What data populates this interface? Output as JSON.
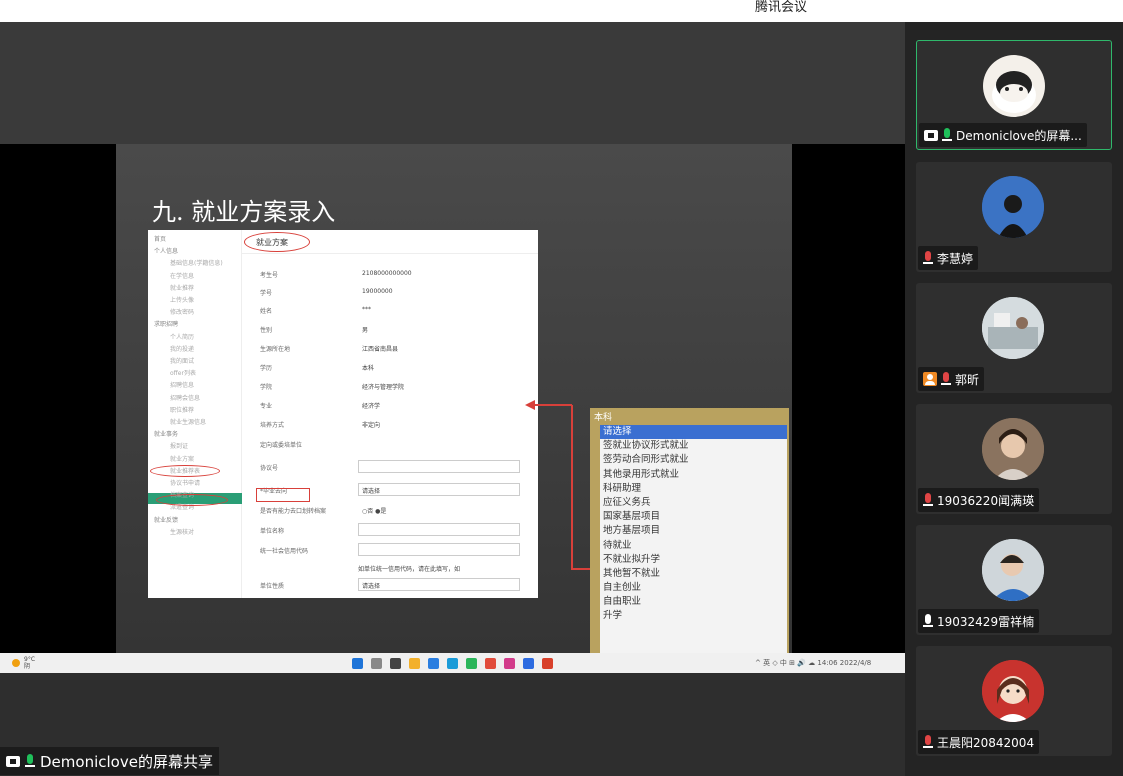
{
  "window": {
    "title": "腾讯会议"
  },
  "slide": {
    "title": "九. 就业方案录入",
    "screenshot": {
      "header_tab": "就业方案",
      "sidebar": [
        {
          "label": "首页",
          "sub": false
        },
        {
          "label": "个人信息",
          "sub": false
        },
        {
          "label": "基础信息(学籍信息)",
          "sub": true
        },
        {
          "label": "在学信息",
          "sub": true
        },
        {
          "label": "就业推荐",
          "sub": true
        },
        {
          "label": "上传头像",
          "sub": true
        },
        {
          "label": "修改密码",
          "sub": true
        },
        {
          "label": "求职招聘",
          "sub": false
        },
        {
          "label": "个人简历",
          "sub": true
        },
        {
          "label": "我的投递",
          "sub": true
        },
        {
          "label": "我的面试",
          "sub": true
        },
        {
          "label": "offer列表",
          "sub": true
        },
        {
          "label": "招聘信息",
          "sub": true
        },
        {
          "label": "招聘会信息",
          "sub": true
        },
        {
          "label": "职位推荐",
          "sub": true
        },
        {
          "label": "就业生源信息",
          "sub": true
        },
        {
          "label": "就业事务",
          "sub": false
        },
        {
          "label": "报到证",
          "sub": true
        },
        {
          "label": "就业方案",
          "sub": true
        },
        {
          "label": "就业推荐表",
          "sub": true
        },
        {
          "label": "协议书申请",
          "sub": true
        },
        {
          "label": "档案查询",
          "sub": true
        },
        {
          "label": "派遣查询",
          "sub": true
        },
        {
          "label": "就业反馈",
          "sub": false
        },
        {
          "label": "生源核对",
          "sub": true
        }
      ],
      "fields": [
        {
          "label": "考生号",
          "value": "2108000000000"
        },
        {
          "label": "学号",
          "value": "19000000"
        },
        {
          "label": "姓名",
          "value": "***"
        },
        {
          "label": "性别",
          "value": "男"
        },
        {
          "label": "生源所在地",
          "value": "江西省南昌县"
        },
        {
          "label": "学历",
          "value": "本科"
        },
        {
          "label": "学院",
          "value": "经济与管理学院"
        },
        {
          "label": "专业",
          "value": "经济学"
        },
        {
          "label": "培养方式",
          "value": "非定向"
        },
        {
          "label": "定向或委培单位",
          "value": ""
        },
        {
          "label": "协议号",
          "value": ""
        },
        {
          "label": "*毕业去向",
          "value": "请选择"
        },
        {
          "label": "是否有能力去口划转档案",
          "value": "○否 ●是"
        },
        {
          "label": "单位名称",
          "value": ""
        },
        {
          "label": "统一社会信用代码",
          "value": ""
        },
        {
          "label": "",
          "value": "如单位统一信用代码，请在此填写，如"
        },
        {
          "label": "单位性质",
          "value": "请选择"
        }
      ]
    },
    "dropdown": {
      "header": "本科",
      "options": [
        "请选择",
        "签就业协议形式就业",
        "签劳动合同形式就业",
        "其他录用形式就业",
        "科研助理",
        "应征义务兵",
        "国家基层项目",
        "地方基层项目",
        "待就业",
        "不就业拟升学",
        "其他暂不就业",
        "自主创业",
        "自由职业",
        "升学"
      ],
      "selected": "请选择"
    }
  },
  "taskbar": {
    "weather_temp": "9°C",
    "weather_text": "阴",
    "tray_text": "^ 英 ◇ 中 ⊞ 🔊 ☁ 14:06 2022/4/8"
  },
  "share_label": "Demoniclove的屏幕共享",
  "participants": [
    {
      "name": "Demoniclove的屏幕...",
      "mic": "on",
      "sharing": true,
      "active": true,
      "avatar": "panda"
    },
    {
      "name": "李慧婷",
      "mic": "off",
      "sharing": false,
      "active": false,
      "avatar": "night"
    },
    {
      "name": "郭昕",
      "mic": "off",
      "sharing": false,
      "active": false,
      "badge": true,
      "avatar": "room"
    },
    {
      "name": "19036220闻满瑛",
      "mic": "off",
      "sharing": false,
      "active": false,
      "avatar": "girl1"
    },
    {
      "name": "19032429雷祥楠",
      "mic": "white",
      "sharing": false,
      "active": false,
      "avatar": "girl2"
    },
    {
      "name": "王晨阳20842004",
      "mic": "off",
      "sharing": false,
      "active": false,
      "avatar": "cartoon"
    }
  ],
  "colors": {
    "accent_green": "#2fb86b",
    "mic_green": "#1fc05a",
    "select_blue": "#3a6fd1",
    "highlight_red": "#d8403a",
    "sidebar_active": "#2a9e76"
  }
}
